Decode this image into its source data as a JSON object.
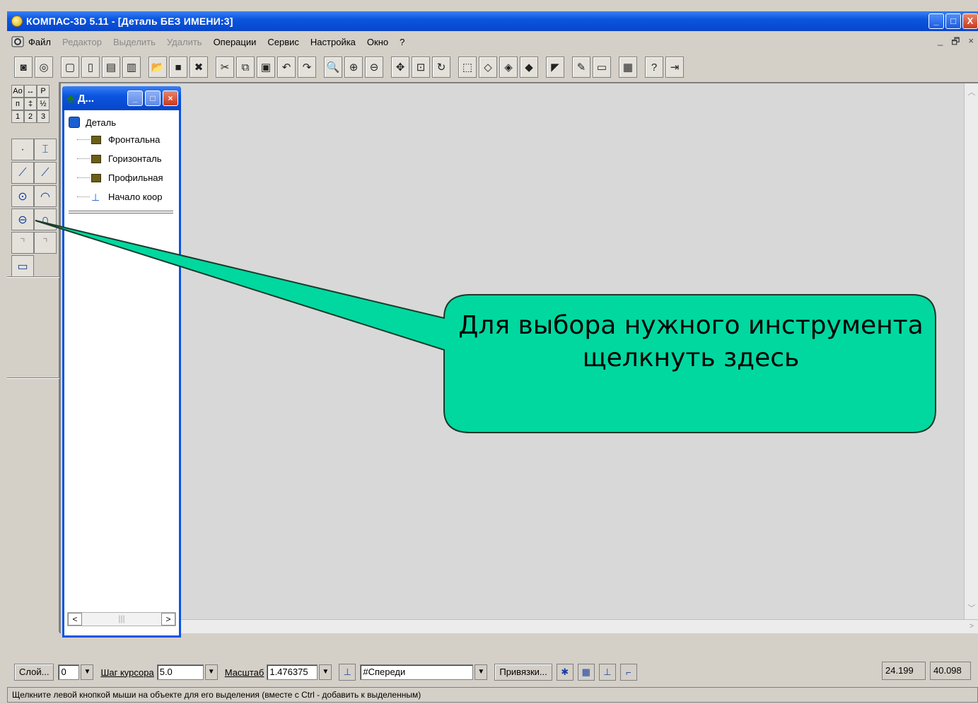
{
  "window": {
    "title": "КОМПАС-3D 5.11 - [Деталь БЕЗ ИМЕНИ:3]",
    "buttons": {
      "minimize": "_",
      "maximize": "□",
      "close": "X"
    }
  },
  "menu": {
    "items": [
      {
        "label": "Файл",
        "enabled": true
      },
      {
        "label": "Редактор",
        "enabled": false
      },
      {
        "label": "Выделить",
        "enabled": false
      },
      {
        "label": "Удалить",
        "enabled": false
      },
      {
        "label": "Операции",
        "enabled": true
      },
      {
        "label": "Сервис",
        "enabled": true
      },
      {
        "label": "Настройка",
        "enabled": true
      },
      {
        "label": "Окно",
        "enabled": true
      },
      {
        "label": "?",
        "enabled": true
      }
    ],
    "doc_controls": [
      "_",
      "🗗",
      "×"
    ]
  },
  "toolbar": {
    "buttons": [
      {
        "icon": "new-part-icon",
        "glyph": "◙"
      },
      {
        "icon": "new-assembly-icon",
        "glyph": "◎"
      },
      {
        "icon": "new-sheet-icon",
        "glyph": "▢"
      },
      {
        "icon": "new-fragment-icon",
        "glyph": "▯"
      },
      {
        "icon": "new-text-icon",
        "glyph": "▤"
      },
      {
        "icon": "new-spec-icon",
        "glyph": "▥"
      },
      {
        "icon": "open-icon",
        "glyph": "📂"
      },
      {
        "icon": "save-icon",
        "glyph": "■"
      },
      {
        "icon": "delete-icon",
        "glyph": "✖"
      },
      {
        "icon": "cut-icon",
        "glyph": "✂"
      },
      {
        "icon": "copy-icon",
        "glyph": "⧉"
      },
      {
        "icon": "paste-icon",
        "glyph": "▣"
      },
      {
        "icon": "undo-icon",
        "glyph": "↶"
      },
      {
        "icon": "redo-icon",
        "glyph": "↷"
      },
      {
        "icon": "zoom-window-icon",
        "glyph": "🔍"
      },
      {
        "icon": "zoom-in-icon",
        "glyph": "⊕"
      },
      {
        "icon": "zoom-out-icon",
        "glyph": "⊖"
      },
      {
        "icon": "pan-icon",
        "glyph": "✥"
      },
      {
        "icon": "zoom-all-icon",
        "glyph": "⊡"
      },
      {
        "icon": "rotate-icon",
        "glyph": "↻"
      },
      {
        "icon": "wireframe-icon",
        "glyph": "⬚"
      },
      {
        "icon": "hidden-lines-icon",
        "glyph": "◇"
      },
      {
        "icon": "hidden-thin-icon",
        "glyph": "◈"
      },
      {
        "icon": "shaded-icon",
        "glyph": "◆"
      },
      {
        "icon": "perspective-icon",
        "glyph": "◤"
      },
      {
        "icon": "sketch-icon",
        "glyph": "✎"
      },
      {
        "icon": "properties-icon",
        "glyph": "▭"
      },
      {
        "icon": "calculator-icon",
        "glyph": "▦"
      },
      {
        "icon": "help-pointer-icon",
        "glyph": "?"
      },
      {
        "icon": "exit-icon",
        "glyph": "⇥"
      }
    ]
  },
  "left_panel": {
    "mini": [
      "Ао",
      "↔",
      "Р",
      "п",
      "‡",
      "½",
      "1",
      "2",
      "3"
    ],
    "tools": [
      {
        "icon": "point-tool-icon",
        "glyph": "·",
        "enabled": true
      },
      {
        "icon": "auxiliary-lines-icon",
        "glyph": "⌶",
        "enabled": true
      },
      {
        "icon": "segment-tool-icon",
        "glyph": "⟋",
        "enabled": true
      },
      {
        "icon": "polyline-tool-icon",
        "glyph": "⟋",
        "enabled": true
      },
      {
        "icon": "circle-tool-icon",
        "glyph": "⊙",
        "enabled": true
      },
      {
        "icon": "arc-tool-icon",
        "glyph": "◠",
        "enabled": true
      },
      {
        "icon": "ellipse-tool-icon",
        "glyph": "⊖",
        "enabled": true
      },
      {
        "icon": "spline-tool-icon",
        "glyph": "∩",
        "enabled": true
      },
      {
        "icon": "chamfer-tool-icon",
        "glyph": "⌝",
        "enabled": false
      },
      {
        "icon": "fillet-tool-icon",
        "glyph": "⌝",
        "enabled": false
      },
      {
        "icon": "rectangle-tool-icon",
        "glyph": "▭",
        "enabled": true
      }
    ]
  },
  "tree": {
    "title": "Д...",
    "root": "Деталь",
    "nodes": [
      {
        "label": "Фронтальна",
        "type": "plane"
      },
      {
        "label": "Горизонталь",
        "type": "plane"
      },
      {
        "label": "Профильная",
        "type": "plane"
      },
      {
        "label": "Начало коор",
        "type": "origin"
      }
    ],
    "scroll": {
      "left": "<",
      "mid": "|||",
      "right": ">"
    }
  },
  "callout": {
    "text": "Для выбора нужного инструмента щелкнуть здесь",
    "fill": "#00d8a0",
    "stroke": "#1a3a2a"
  },
  "props": {
    "layer_btn": "Слой...",
    "layer_value": "0",
    "step_label": "Шаг курсора",
    "step_value": "5.0",
    "scale_label": "Масштаб",
    "scale_value": "1.476375",
    "view_value": "#Спереди",
    "snaps_btn": "Привязки...",
    "coord_x": "24.199",
    "coord_y": "40.098"
  },
  "status": {
    "text": "Щелкните левой кнопкой мыши на объекте для его выделения (вместе с Ctrl - добавить к выделенным)"
  }
}
